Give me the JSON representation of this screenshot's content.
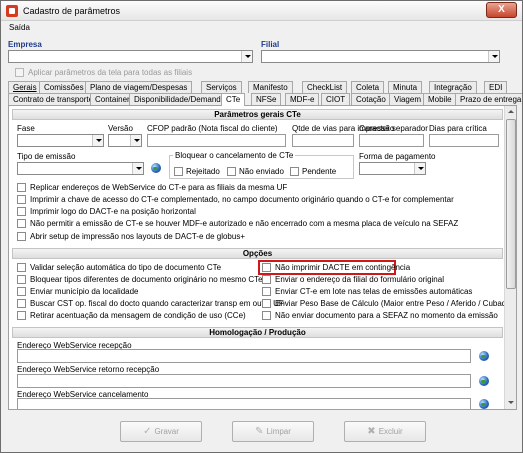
{
  "window": {
    "title": "Cadastro de parâmetros",
    "close_glyph": "X"
  },
  "menu": {
    "sair": "Saída"
  },
  "top": {
    "empresa_label": "Empresa",
    "filial_label": "Filial",
    "apply_all_label": "Aplicar parâmetros da tela para todas as filiais"
  },
  "tabs_row1": [
    {
      "label": "Gerais",
      "u": "G"
    },
    {
      "label": "Comissões",
      "u": "o"
    },
    {
      "label": "Plano de viagem/Despesas",
      "u": "P"
    },
    {
      "label": "Serviços",
      "u": "r"
    },
    {
      "label": "Manifesto",
      "u": "M"
    },
    {
      "label": "CheckList",
      "u": "L"
    },
    {
      "label": "Coleta",
      "u": "a"
    },
    {
      "label": "Minuta",
      "u": "M"
    },
    {
      "label": "Integração",
      "u": "I"
    },
    {
      "label": "EDI",
      "u": "E"
    }
  ],
  "tabs_row2": [
    {
      "label": "Contrato de transporte"
    },
    {
      "label": "Container"
    },
    {
      "label": "Disponibilidade/Demanda"
    },
    {
      "label": "CTe"
    },
    {
      "label": "NFSe"
    },
    {
      "label": "MDF-e"
    },
    {
      "label": "CIOT"
    },
    {
      "label": "Cotação"
    },
    {
      "label": "Viagem"
    },
    {
      "label": "Mobile"
    },
    {
      "label": "Prazo de entrega"
    }
  ],
  "gerais_cte": {
    "title": "Parâmetros gerais CTe",
    "fase": "Fase",
    "versao": "Versão",
    "cfop": "CFOP padrão (Nota fiscal do cliente)",
    "qtde_vias": "Qtde de vias para impressão",
    "caractere": "Caracter separador",
    "dias": "Dias para crítica",
    "tipo_emissao": "Tipo de emissão",
    "bloquear_group": "Bloquear o cancelamento de CTe",
    "rejeitado": "Rejeitado",
    "nao_enviado": "Não enviado",
    "pendente": "Pendente",
    "forma_pagamento": "Forma de pagamento",
    "checks": [
      "Replicar endereços de WebService do CT-e para as filiais da mesma UF",
      "Imprimir a chave de acesso do CT-e complementado, no campo documento originário quando o CT-e for complementar",
      "Imprimir logo do DACT-e na posição horizontal",
      "Não permitir a emissão de CT-e se houver MDF-e autorizado e não encerrado com a mesma placa de veículo na SEFAZ",
      "Abrir setup de impressão nos layouts de DACT-e de globus+"
    ]
  },
  "opcoes": {
    "title": "Opções",
    "left": [
      "Validar seleção automática do tipo de documento CTe",
      "Bloquear tipos diferentes de documento originário no mesmo CTe",
      "Enviar município da localidade",
      "Buscar CST op. fiscal do docto quando caracterizar transp em outra UF",
      "Retirar acentuação da mensagem de condição de uso (CCe)"
    ],
    "right": [
      "Não imprimir DACTE em contingência",
      "Enviar o endereço da filial do formulário original",
      "Enviar CT-e em lote nas telas de emissões automáticas",
      "Enviar Peso Base de Cálculo (Maior entre Peso / Aferido / Cubado)",
      "Não enviar documento para a SEFAZ no momento da emissão"
    ]
  },
  "homolog": {
    "title": "Homologação / Produção",
    "fields": [
      "Endereço WebService recepção",
      "Endereço WebService retorno recepção",
      "Endereço WebService cancelamento"
    ]
  },
  "buttons": {
    "gravar": "Gravar",
    "limpar": "Limpar",
    "excluir": "Excluir"
  },
  "icons": {
    "app": "app-icon",
    "globe": "globe-icon",
    "gravar": "checkmark-icon",
    "limpar": "broom-icon",
    "excluir": "delete-icon"
  },
  "colors": {
    "accent": "#1e3c8c",
    "highlight": "#d01818"
  }
}
